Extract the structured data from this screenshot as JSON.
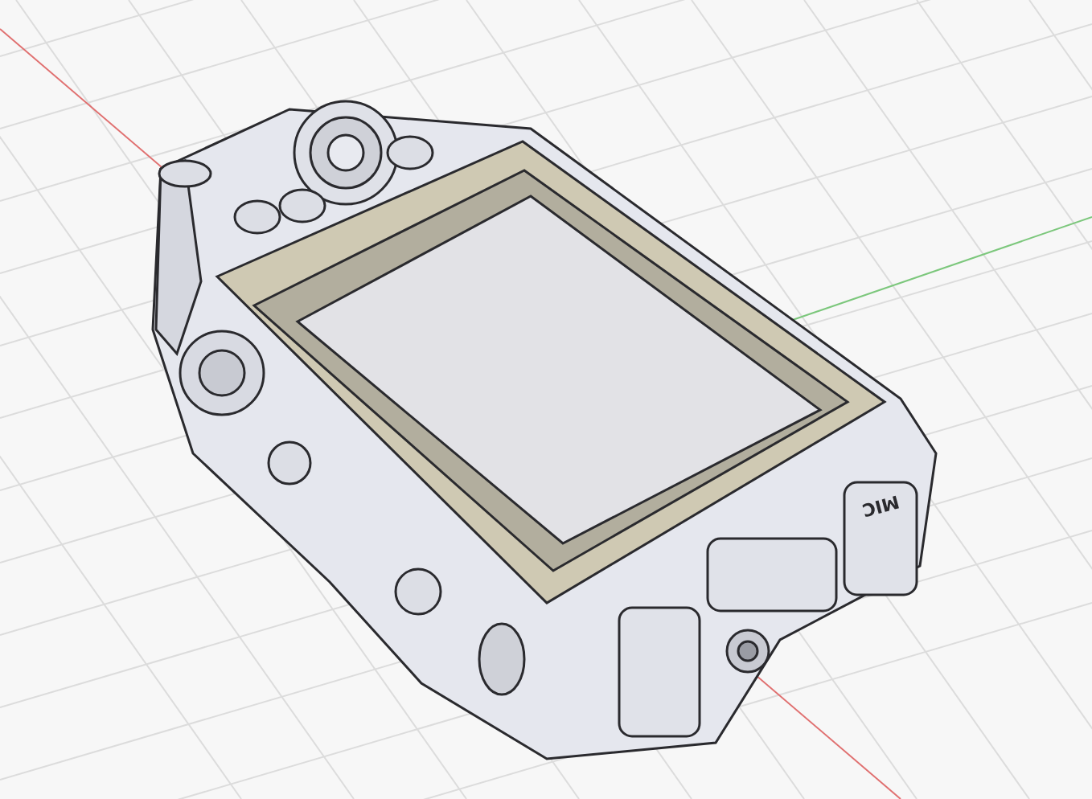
{
  "viewport": {
    "port_labels": [
      {
        "text": "MIC"
      }
    ]
  }
}
